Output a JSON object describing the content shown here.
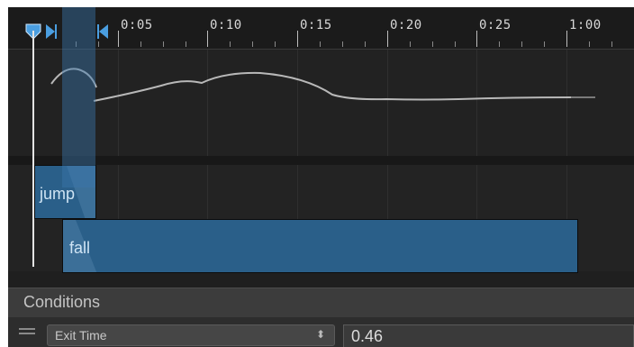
{
  "timeline": {
    "ticks": [
      "0:05",
      "0:10",
      "0:15",
      "0:20",
      "0:25",
      "1:00"
    ]
  },
  "clips": {
    "first": "jump",
    "second": "fall"
  },
  "conditions": {
    "header": "Conditions",
    "parameter": "Exit Time",
    "parameter_arrows": "⬍",
    "value": "0.46"
  },
  "colors": {
    "clip": "#2a5f89",
    "selection": "#3a76aa",
    "marker": "#4a9ee0"
  },
  "icons": [
    "start-marker-icon",
    "transition-start-icon",
    "transition-end-icon",
    "drag-handle-icon",
    "dropdown-arrows-icon"
  ]
}
